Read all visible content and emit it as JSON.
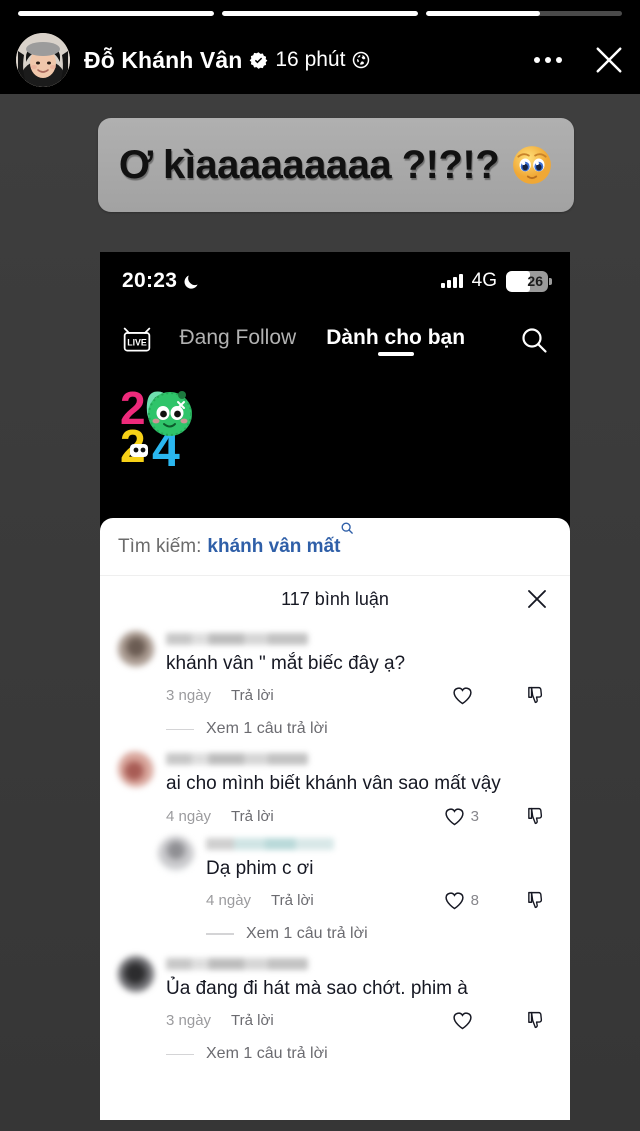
{
  "story": {
    "progress_segments": [
      100,
      100,
      58
    ],
    "author": "Đỗ Khánh Vân",
    "verified": true,
    "time_ago": "16 phút",
    "audience_icon": "globe-icon",
    "more_icon": "more-options-icon",
    "close_icon": "close-icon",
    "caption_text": "Ơ kìaaaaaaaaa ?!?!?",
    "caption_emoji": "pleading-face-emoji",
    "bubble_color": "#a8a8a8",
    "background_color": "#3a3a3a"
  },
  "inner_screenshot": {
    "app": "tiktok",
    "status_bar": {
      "time": "20:23",
      "moon_icon": "crescent-moon-icon",
      "signal_icon": "signal-bars-icon",
      "network": "4G",
      "battery_percent": "26"
    },
    "nav": {
      "live_label": "LIVE",
      "tabs": [
        {
          "label": "Đang Follow",
          "active": false
        },
        {
          "label": "Dành cho bạn",
          "active": true
        }
      ],
      "search_icon": "search-icon"
    },
    "logo": "2024-logo",
    "search_banner": {
      "label": "Tìm kiếm:",
      "query": "khánh vân mất",
      "icon": "search-icon",
      "query_color": "#2f5fa8"
    },
    "comment_sheet": {
      "title": "117 bình luận",
      "close_icon": "close-icon",
      "comments": [
        {
          "text": "khánh vân \" mắt biếc đây ạ?",
          "time": "3 ngày",
          "reply_label": "Trả lời",
          "likes": "",
          "view_replies": "Xem 1 câu trả lời",
          "nested": false
        },
        {
          "text": "ai cho mình biết khánh vân sao mất vậy",
          "time": "4 ngày",
          "reply_label": "Trả lời",
          "likes": "3",
          "view_replies": "",
          "nested": false
        },
        {
          "text": "Dạ phim c ơi",
          "time": "4 ngày",
          "reply_label": "Trả lời",
          "likes": "8",
          "view_replies": "Xem 1 câu trả lời",
          "nested": true
        },
        {
          "text": "Ủa đang đi hát mà sao chớt. phim à",
          "time": "3 ngày",
          "reply_label": "Trả lời",
          "likes": "",
          "view_replies": "Xem 1 câu trả lời",
          "nested": false
        }
      ]
    }
  }
}
